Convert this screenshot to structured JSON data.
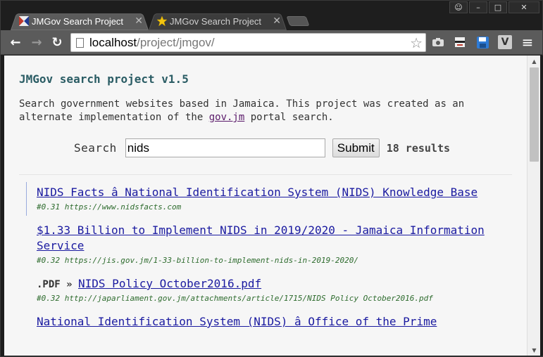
{
  "window": {
    "controls": {
      "user": "☺",
      "minimize": "–",
      "maximize": "□",
      "close": "✕"
    }
  },
  "tabs": [
    {
      "title": "JMGov Search Project",
      "close": "✕",
      "icon": "jamaica-flag-icon"
    },
    {
      "title": "JMGov Search Project",
      "close": "✕",
      "icon": "star-icon"
    }
  ],
  "toolbar": {
    "back": "←",
    "forward": "→",
    "reload": "↻",
    "url_host": "localhost",
    "url_path": "/project/jmgov/",
    "bookmark_star": "☆",
    "ext_v": "V",
    "menu": "≡"
  },
  "page": {
    "title": "JMGov search project v1.5",
    "intro_before": "Search government websites based in Jamaica. This project was created as an alternate implementation of the ",
    "intro_link": "gov.jm",
    "intro_after": " portal search.",
    "search_label": "Search",
    "search_value": "nids",
    "submit_label": "Submit",
    "result_count": "18 results"
  },
  "results": [
    {
      "filetype": "",
      "title": "NIDS Facts â National Identification System (NIDS) Knowledge Base",
      "meta": "#0.31 https://www.nidsfacts.com"
    },
    {
      "filetype": "",
      "title": "$1.33 Billion to Implement NIDS in 2019/2020 - Jamaica Information Service",
      "meta": "#0.32 https://jis.gov.jm/1-33-billion-to-implement-nids-in-2019-2020/"
    },
    {
      "filetype": ".PDF » ",
      "title": "NIDS Policy October2016.pdf",
      "meta": "#0.32 http://japarliament.gov.jm/attachments/article/1715/NIDS Policy October2016.pdf"
    },
    {
      "filetype": "",
      "title": "National Identification System (NIDS) â Office of the Prime",
      "meta": ""
    }
  ],
  "colors": {
    "title": "#2a5c64",
    "link": "#1a1aa0",
    "meta": "#2d6b2d",
    "visited": "#5a1a6a"
  }
}
